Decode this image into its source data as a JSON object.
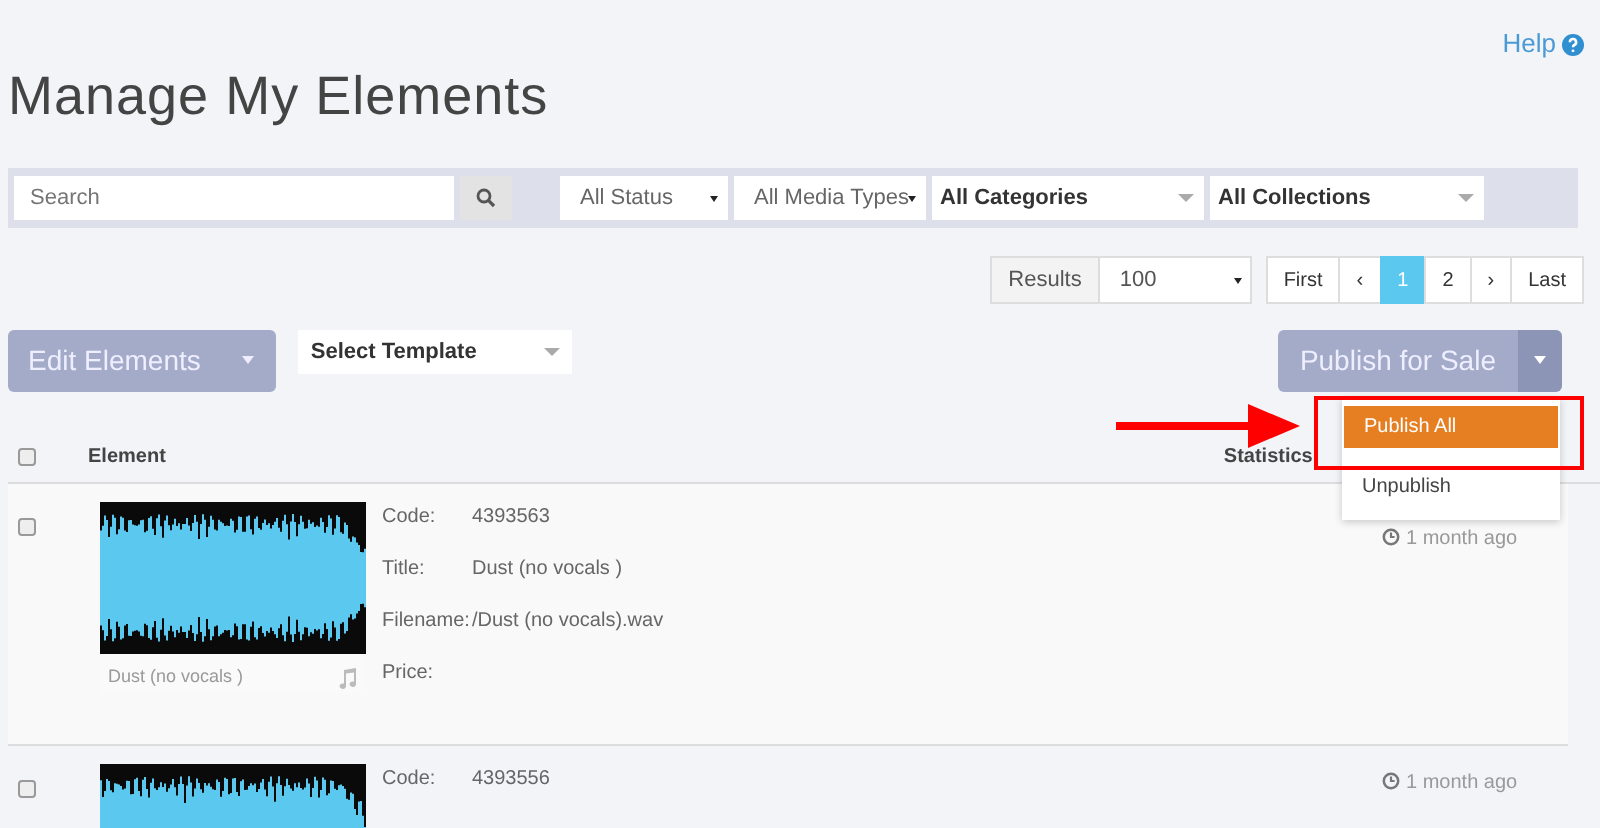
{
  "help_link": "Help",
  "page_title": "Manage My Elements",
  "filters": {
    "search": {
      "placeholder": "Search"
    },
    "selects": [
      {
        "kind": "plain",
        "value": "All Status"
      },
      {
        "kind": "plain",
        "value": "All Media Types"
      },
      {
        "kind": "bold",
        "value": "All Categories"
      },
      {
        "kind": "bold",
        "value": "All Collections"
      }
    ]
  },
  "results": {
    "label": "Results",
    "value": "100"
  },
  "pagination": [
    {
      "label": "First",
      "selected": false
    },
    {
      "label": "‹",
      "selected": false
    },
    {
      "label": "1",
      "selected": true
    },
    {
      "label": "2",
      "selected": false
    },
    {
      "label": "›",
      "selected": false
    },
    {
      "label": "Last",
      "selected": false
    }
  ],
  "toolbar": {
    "edit_button": "Edit Elements",
    "template_select": "Select Template",
    "publish_button": "Publish for Sale",
    "publish_menu": [
      {
        "label": "Publish All",
        "selected": true
      },
      {
        "label": "Unpublish",
        "selected": false
      }
    ]
  },
  "table": {
    "select_all_checked": false,
    "columns": [
      "Element",
      "Statistics"
    ],
    "rows": [
      {
        "checked": false,
        "caption": "Dust (no vocals )",
        "fields": [
          {
            "label": "Code:",
            "value": "4393563"
          },
          {
            "label": "Title:",
            "value": "Dust (no vocals )"
          },
          {
            "label": "Filename:",
            "value": "/Dust (no vocals).wav"
          },
          {
            "label": "Price:"
          }
        ],
        "time": "1 month ago"
      },
      {
        "checked": false,
        "fields": [
          {
            "label": "Code:",
            "value": "4393556"
          }
        ],
        "time": "1 month ago"
      }
    ]
  }
}
